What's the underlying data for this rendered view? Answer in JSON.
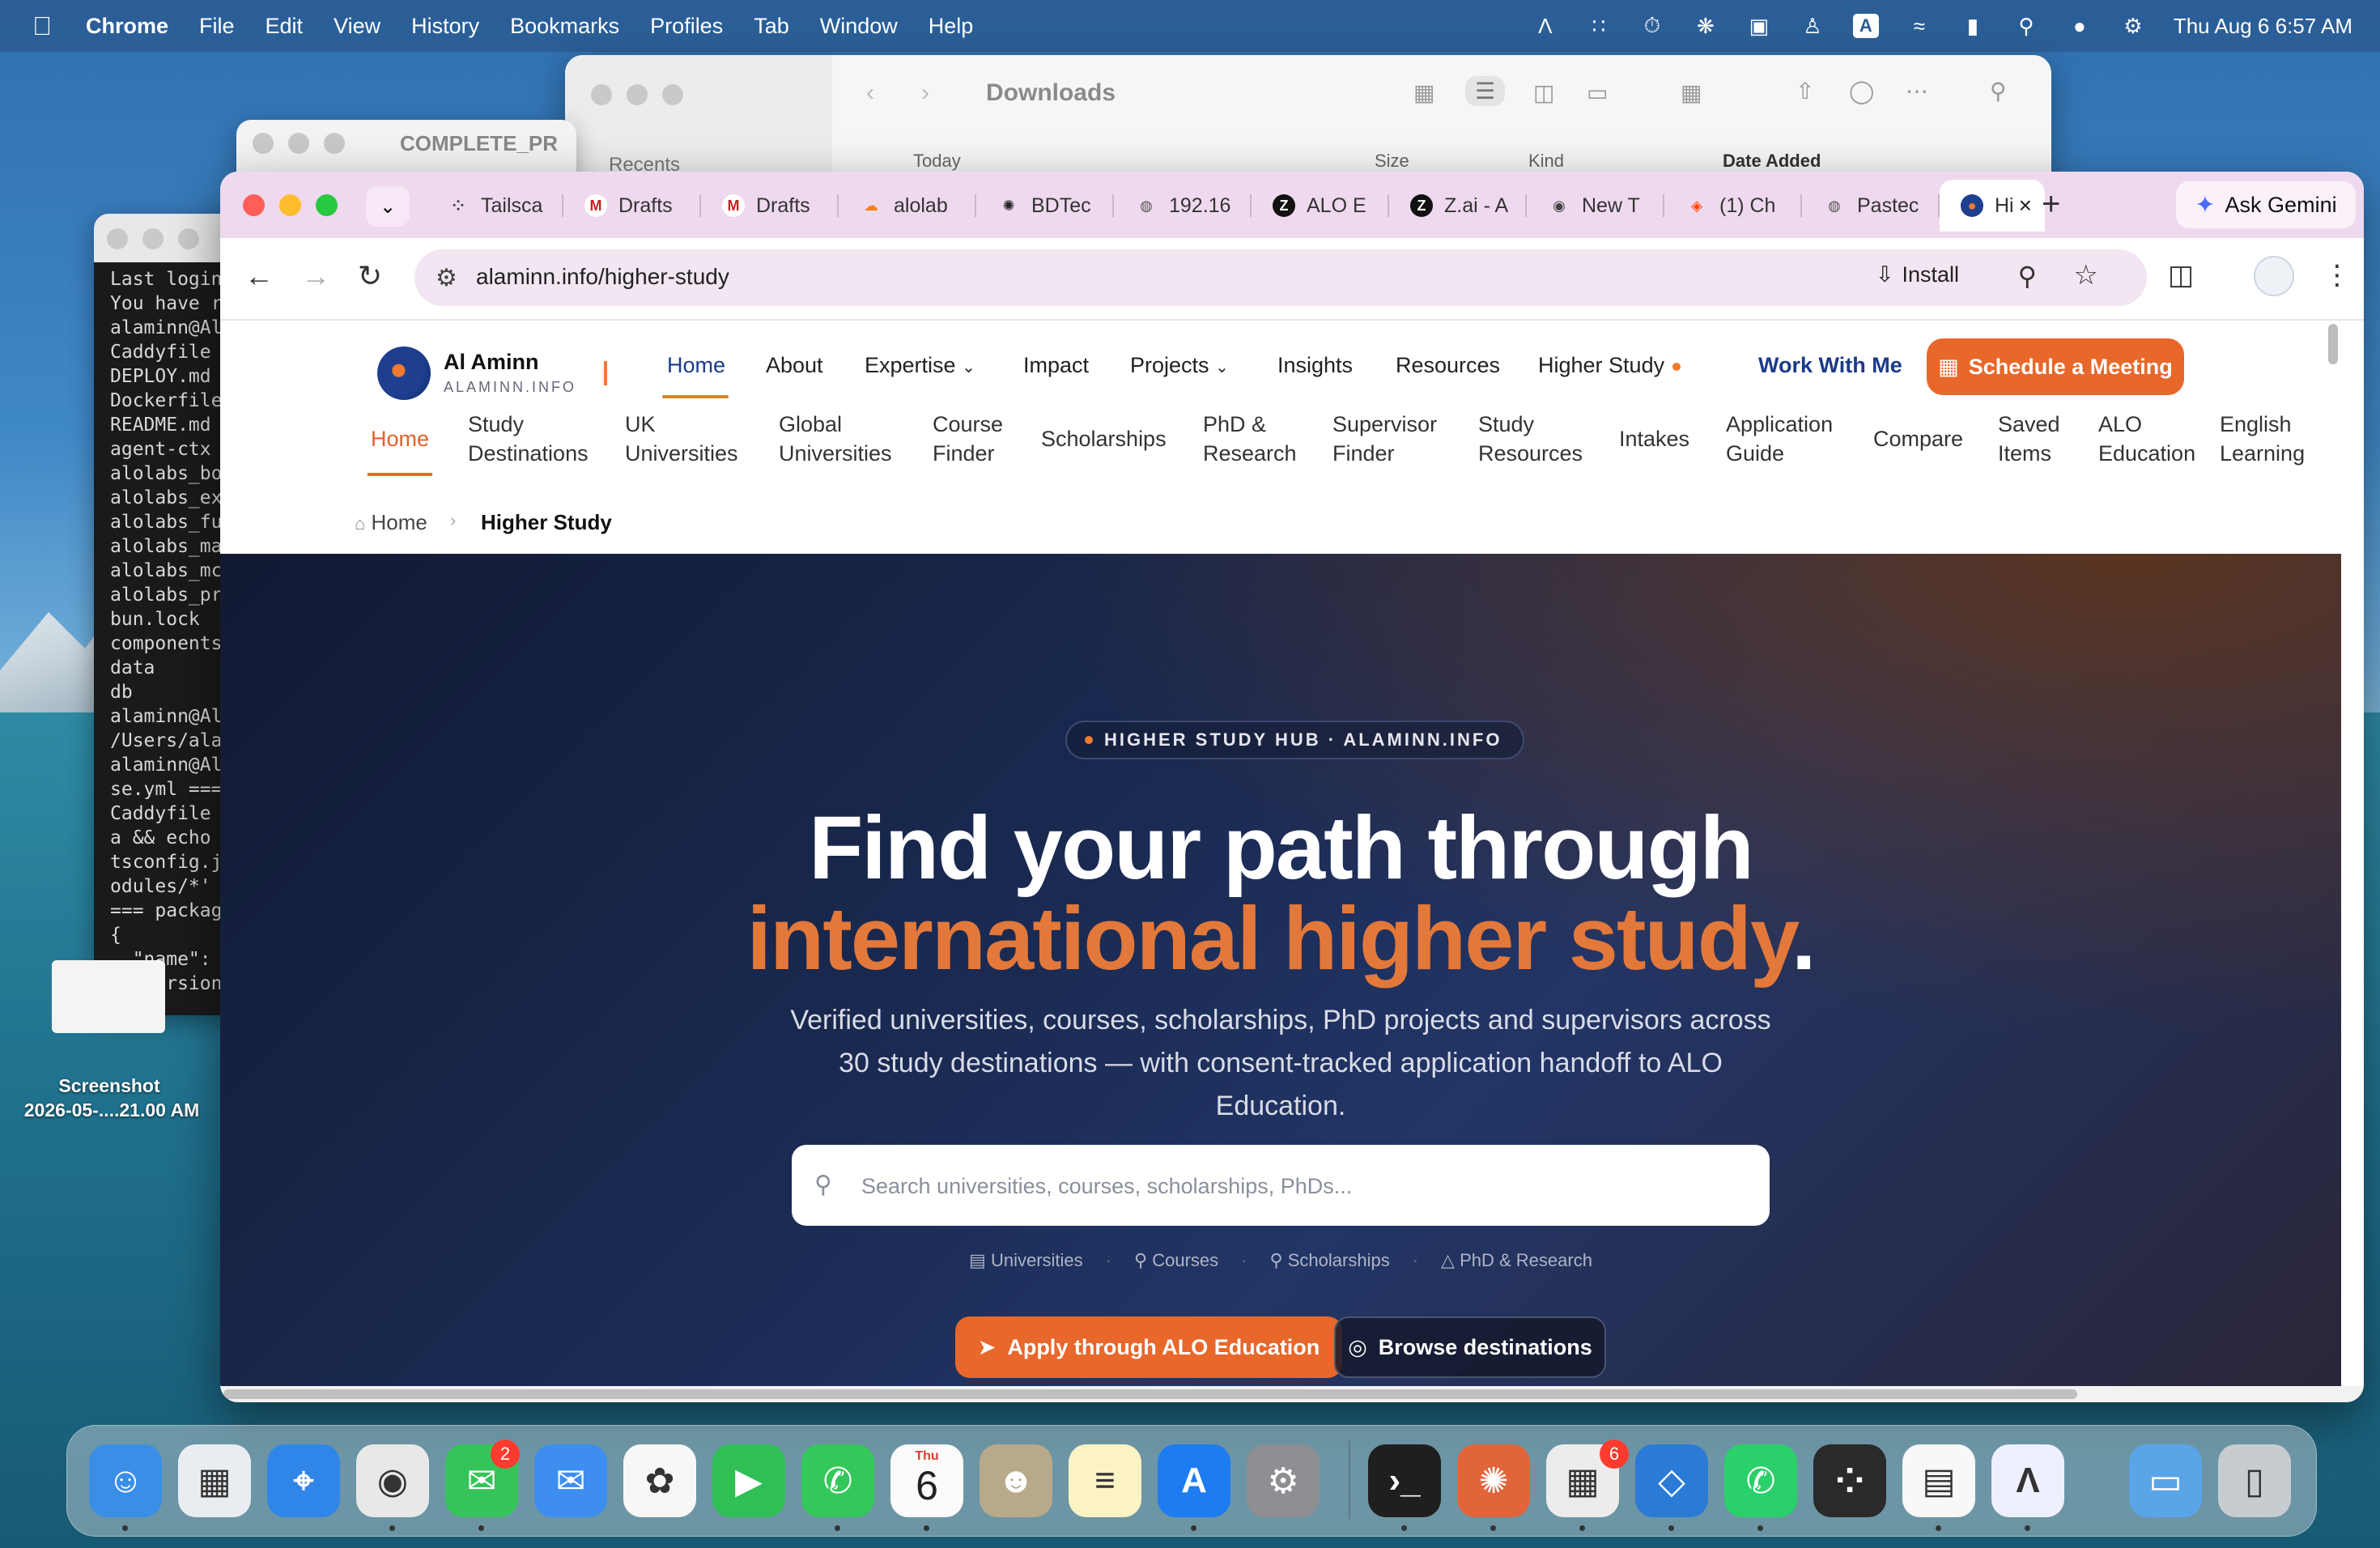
{
  "menubar": {
    "app": "Chrome",
    "items": [
      "File",
      "Edit",
      "View",
      "History",
      "Bookmarks",
      "Profiles",
      "Tab",
      "Window",
      "Help"
    ],
    "datetime": "Thu Aug 6  6:57 AM",
    "input_indicator": "A"
  },
  "finder": {
    "title": "Downloads",
    "sidebar_item": "Recents",
    "group": "Today",
    "columns": [
      "Size",
      "Kind",
      "Date Added"
    ]
  },
  "doc_window": {
    "title": "COMPLETE_PR"
  },
  "terminal": {
    "lines": [
      "Last login",
      "You have r",
      "alaminn@Al",
      "Caddyfile",
      "DEPLOY.md",
      "Dockerfile",
      "README.md",
      "agent-ctx",
      "alolabs_bo",
      "alolabs_ex",
      "alolabs_fu",
      "alolabs_ma",
      "alolabs_mc",
      "alolabs_pr",
      "bun.lock",
      "components",
      "data",
      "db",
      "alaminn@Al",
      "/Users/ala",
      "alaminn@Al",
      "se.yml ===",
      "Caddyfile",
      "a && echo",
      "tsconfig.j",
      "odules/*'",
      "=== packag",
      "{",
      "  \"name\":",
      "  \"version"
    ]
  },
  "desktop": {
    "screenshot_label_1": "Screenshot",
    "screenshot_label_2": "2026-05-....21.00 AM"
  },
  "tabs": [
    {
      "label": "Tailsca",
      "icon": "tailscale-icon"
    },
    {
      "label": "Drafts",
      "icon": "gmail-icon"
    },
    {
      "label": "Drafts",
      "icon": "gmail-icon"
    },
    {
      "label": "alolab",
      "icon": "cloudflare-icon"
    },
    {
      "label": "BDTec",
      "icon": "openai-icon"
    },
    {
      "label": "192.16",
      "icon": "globe-icon"
    },
    {
      "label": "ALO E",
      "icon": "zai-icon"
    },
    {
      "label": "Z.ai - A",
      "icon": "zai-icon"
    },
    {
      "label": "New T",
      "icon": "chrome-icon"
    },
    {
      "label": "(1) Ch",
      "icon": "chat-icon"
    },
    {
      "label": "Pastec",
      "icon": "globe-icon"
    },
    {
      "label": "Hi",
      "icon": "site-icon"
    }
  ],
  "gemini_label": "Ask Gemini",
  "address": {
    "url": "alaminn.info/higher-study",
    "install_label": "Install"
  },
  "site": {
    "name": "Al Aminn",
    "domain": "ALAMINN.INFO",
    "nav": [
      "Home",
      "About",
      "Expertise",
      "Impact",
      "Projects",
      "Insights",
      "Resources",
      "Higher Study"
    ],
    "work_label": "Work With Me",
    "schedule_label": "Schedule a Meeting",
    "subnav": [
      [
        "Home",
        ""
      ],
      [
        "Study",
        "Destinations"
      ],
      [
        "UK",
        "Universities"
      ],
      [
        "Global",
        "Universities"
      ],
      [
        "Course",
        "Finder"
      ],
      [
        "Scholarships",
        ""
      ],
      [
        "PhD &",
        "Research"
      ],
      [
        "Supervisor",
        "Finder"
      ],
      [
        "Study",
        "Resources"
      ],
      [
        "Intakes",
        ""
      ],
      [
        "Application",
        "Guide"
      ],
      [
        "Compare",
        ""
      ],
      [
        "Saved",
        "Items"
      ],
      [
        "ALO",
        "Education"
      ],
      [
        "English",
        "Learning"
      ]
    ],
    "breadcrumb": {
      "home": "Home",
      "current": "Higher Study"
    }
  },
  "hero": {
    "eyebrow": "HIGHER STUDY HUB · ALAMINN.INFO",
    "title_line1": "Find your path through",
    "title_line2": "international higher study",
    "title_dot": ".",
    "lead": "Verified universities, courses, scholarships, PhD projects and supervisors across 30 study destinations — with consent-tracked application handoff to ALO Education.",
    "search_placeholder": "Search universities, courses, scholarships, PhDs...",
    "chips": [
      "Universities",
      "Courses",
      "Scholarships",
      "PhD & Research"
    ],
    "apply_label": "Apply through ALO Education",
    "browse_label": "Browse destinations"
  },
  "dock": {
    "apps": [
      "Finder",
      "Launchpad",
      "Safari",
      "Chrome",
      "Messages",
      "Mail",
      "Photos",
      "FaceTime",
      "Phone",
      "Calendar",
      "Contacts",
      "Notes",
      "App Store",
      "System Settings",
      "Terminal",
      "Claude",
      "Microsoft 365",
      "VS Code",
      "WhatsApp",
      "Apps",
      "Scratchpad",
      "Arc",
      "Downloads",
      "Trash"
    ],
    "messages_badge": "2",
    "office_badge": "6",
    "calendar_month": "Thu",
    "calendar_day": "6"
  },
  "colors": {
    "accent": "#e8672a",
    "brand_blue": "#1b3a8a",
    "hero_bg": "#1a2a52",
    "tabstrip": "#efd9ee"
  }
}
